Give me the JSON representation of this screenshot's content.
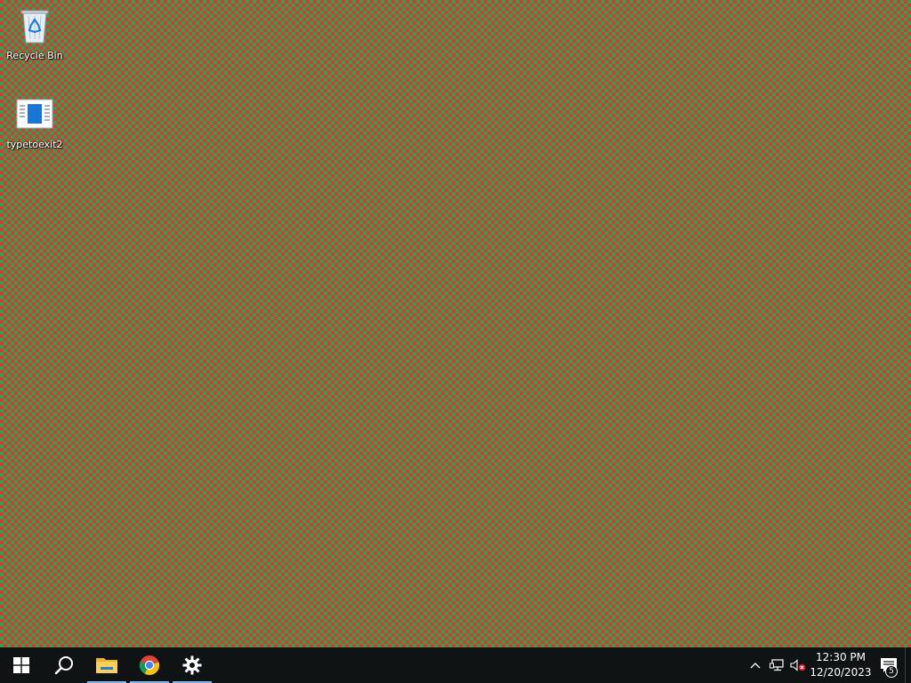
{
  "desktop": {
    "background_colors": [
      "#d63a3a",
      "#2fa34a"
    ],
    "icons": [
      {
        "label": "Recycle Bin",
        "icon": "recycle-bin-icon"
      },
      {
        "label": "typetoexit2",
        "icon": "application-file-icon"
      }
    ]
  },
  "taskbar": {
    "buttons": [
      {
        "name": "Start",
        "icon": "windows-start-icon"
      },
      {
        "name": "Search",
        "icon": "search-icon"
      },
      {
        "name": "File Explorer",
        "icon": "folder-icon",
        "active": true
      },
      {
        "name": "Google Chrome",
        "icon": "chrome-icon",
        "active": true
      },
      {
        "name": "Settings",
        "icon": "gear-icon",
        "active": true
      }
    ],
    "tray": {
      "show_hidden_icon": "chevron-up-icon",
      "network_icon": "network-icon",
      "volume_icon": "volume-muted-icon",
      "time": "12:30 PM",
      "date": "12/20/2023",
      "notification_count": "5"
    }
  }
}
